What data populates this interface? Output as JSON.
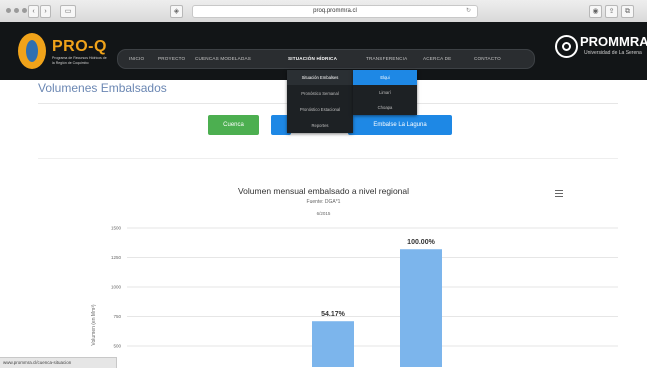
{
  "browser": {
    "url": "proq.prommra.cl",
    "status_url": "www.prommra.cl/cuenca-situacion"
  },
  "brand": {
    "name": "PRO-Q",
    "tagline": "Programa de Recursos Hídricos de la Región de Coquimbo",
    "partner": "PROMMRA",
    "partner_sub": "Universidad de La Serena"
  },
  "nav": {
    "items": [
      "INICIO",
      "PROYECTO",
      "CUENCAS MODELADAS",
      "SITUACIÓN HÍDRICA",
      "TRANSFERENCIA",
      "ACERCA DE",
      "CONTACTO"
    ],
    "active": "SITUACIÓN HÍDRICA"
  },
  "dropdown": {
    "items": [
      "Situación Embalses",
      "Pronóstico Semanal",
      "Pronóstico Estacional",
      "Reportes"
    ],
    "submenu": [
      "Elqui",
      "Limarí",
      "Choapa"
    ],
    "selected": "Elqui"
  },
  "page": {
    "title": "Volumenes Embalsados",
    "buttons": [
      "Cuenca",
      "Embalse La Laguna"
    ]
  },
  "chart_data": {
    "type": "bar",
    "title": "Volumen mensual embalsado a nivel regional",
    "subtitle": "Fuente: DGA*1",
    "period": "6/2015",
    "ylabel": "Volumen (en Mm³)",
    "ytick_labels": [
      "500",
      "750",
      "1000",
      "1250",
      "1500"
    ],
    "ylim": [
      500,
      1500
    ],
    "values": [
      710,
      1320
    ],
    "data_labels": [
      "54.17%",
      "100.00%"
    ],
    "colors": [
      "#7cb5ec",
      "#7cb5ec"
    ]
  },
  "colors": {
    "nav_bg": "#121517",
    "accent_orange": "#f0a31a",
    "title_blue": "#6b87b3",
    "button_green": "#4caf50",
    "button_blue": "#1e88e5"
  }
}
